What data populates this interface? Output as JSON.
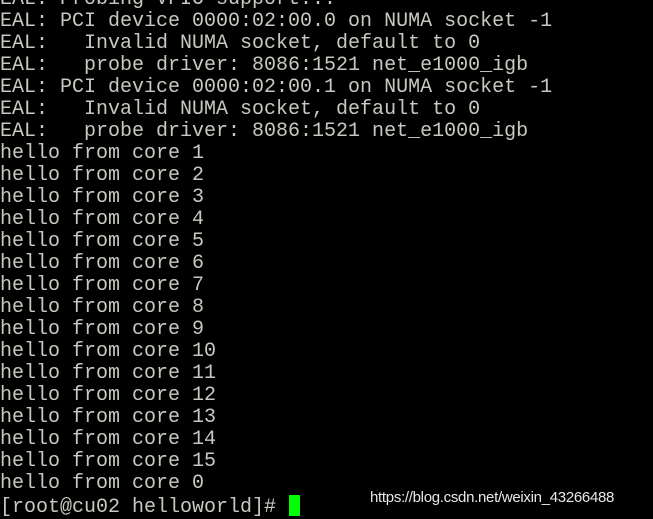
{
  "terminal": {
    "lines": [
      "EAL: Probing VFIO support...",
      "EAL: PCI device 0000:02:00.0 on NUMA socket -1",
      "EAL:   Invalid NUMA socket, default to 0",
      "EAL:   probe driver: 8086:1521 net_e1000_igb",
      "EAL: PCI device 0000:02:00.1 on NUMA socket -1",
      "EAL:   Invalid NUMA socket, default to 0",
      "EAL:   probe driver: 8086:1521 net_e1000_igb",
      "hello from core 1",
      "hello from core 2",
      "hello from core 3",
      "hello from core 4",
      "hello from core 5",
      "hello from core 6",
      "hello from core 7",
      "hello from core 8",
      "hello from core 9",
      "hello from core 10",
      "hello from core 11",
      "hello from core 12",
      "hello from core 13",
      "hello from core 14",
      "hello from core 15",
      "hello from core 0"
    ],
    "prompt": "[root@cu02 helloworld]# ",
    "cursor_color": "#00ff00",
    "text_color": "#c8c8c0",
    "background": "#000000"
  },
  "watermark": "https://blog.csdn.net/weixin_43266488"
}
